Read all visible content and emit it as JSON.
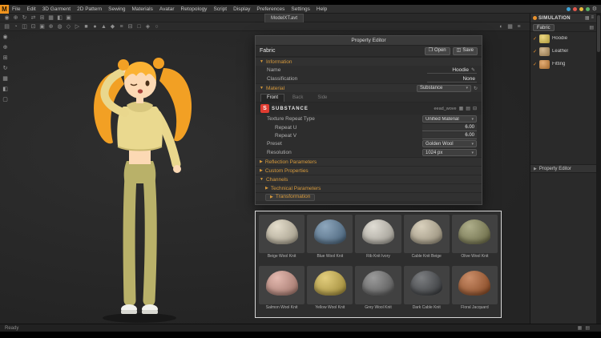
{
  "app": {
    "logo_letter": "M",
    "menu_items": [
      "File",
      "Edit",
      "3D Garment",
      "2D Pattern",
      "Sewing",
      "Materials",
      "Avatar",
      "Retopology",
      "Script",
      "Display",
      "Preferences",
      "Settings",
      "Help"
    ],
    "document_tab": "ModelXT.avt",
    "status_left": "Ready"
  },
  "titlebar_dots": [
    "#3da5d9",
    "#e2574c",
    "#e8b93c",
    "#58b368"
  ],
  "toolbar": {
    "row1": [
      "◉",
      "⊕",
      "↻",
      "⇄",
      "⊞",
      "▦",
      "◧",
      "▣"
    ],
    "row2": [
      "▤",
      "◔",
      "◫",
      "⊡",
      "▣",
      "⊕",
      "◍",
      "◇",
      "▷",
      "■",
      "●",
      "▲",
      "◆",
      "≡",
      "⊟",
      "□",
      "◈",
      "○"
    ],
    "left": [
      "◉",
      "⊕",
      "⊞",
      "↻",
      "▦",
      "◧",
      "▢"
    ],
    "view": [
      "◐",
      "▦",
      "≡"
    ]
  },
  "icons": {
    "open": "❐",
    "save": "◫",
    "edit": "✎",
    "refresh": "↻",
    "dropdown": "▾",
    "expanded": "▼",
    "collapsed": "▶",
    "check": "✓",
    "menu": "≡",
    "grid": "▦",
    "list": "▤",
    "remove": "⊟",
    "gear": "⚙",
    "dot": "●"
  },
  "property_editor": {
    "title": "Property Editor",
    "fabric_label": "Fabric",
    "open_label": "Open",
    "save_label": "Save",
    "information": {
      "header": "Information",
      "name_label": "Name",
      "name_value": "Hoodie",
      "classification_label": "Classification",
      "classification_value": "None"
    },
    "material": {
      "header": "Material",
      "type_value": "Substance",
      "tabs": [
        "Front",
        "Back",
        "Side"
      ],
      "brand": "SUBSTANCE",
      "file_name": "eead_wove",
      "texture_repeat_label": "Texture Repeat Type",
      "texture_repeat_value": "Unified Material",
      "repeat_u_label": "Repeat U",
      "repeat_u_value": "6.00",
      "repeat_v_label": "Repeat V",
      "repeat_v_value": "6.00",
      "preset_label": "Preset",
      "preset_value": "Golden Wool",
      "resolution_label": "Resolution",
      "resolution_value": "1024 px"
    },
    "collapsed_sections": {
      "reflection": "Reflection Parameters",
      "custom": "Custom Properties",
      "channels": "Channels",
      "technical": "Technical Parameters",
      "transformation": "Transformation"
    }
  },
  "gallery": {
    "items": [
      {
        "name": "Beige Wool Knit",
        "color": "#d9cfb6"
      },
      {
        "name": "Blue Wool Knit",
        "color": "#5c80a0"
      },
      {
        "name": "Rib Knit Ivory",
        "color": "#d3cec2"
      },
      {
        "name": "Cable Knit Beige",
        "color": "#c9bda1"
      },
      {
        "name": "Olive Wool Knit",
        "color": "#8b8b58"
      },
      {
        "name": "Salmon Wool Knit",
        "color": "#d89b8d"
      },
      {
        "name": "Yellow Wool Knit",
        "color": "#d6b845"
      },
      {
        "name": "Grey Wool Knit",
        "color": "#707070"
      },
      {
        "name": "Dark Cable Knit",
        "color": "#43464a"
      },
      {
        "name": "Floral Jacquard",
        "color": "#b35c28"
      }
    ]
  },
  "right_panel": {
    "title": "SIMULATION",
    "accent_color": "#e8912d",
    "tab_label": "Fabric",
    "objects": [
      {
        "label": "Hoodie",
        "color": "#e5c84d"
      },
      {
        "label": "Leather",
        "color": "#c09a62"
      },
      {
        "label": "Fitting",
        "color": "#d98a3a"
      }
    ],
    "property_editor_label": "Property Editor"
  }
}
